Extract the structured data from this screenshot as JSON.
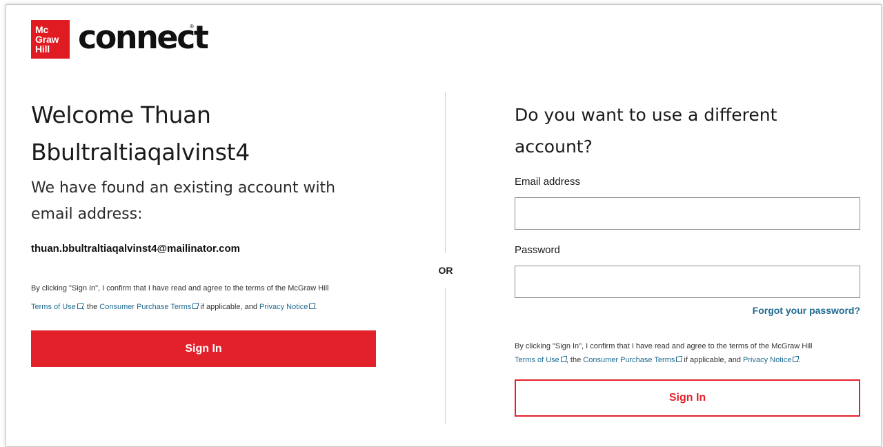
{
  "logo": {
    "line1": "Mc",
    "line2": "Graw",
    "line3": "Hill",
    "brand": "connect",
    "reg": "®"
  },
  "left": {
    "welcome_line1": "Welcome Thuan",
    "welcome_line2": "Bbultraltiaqalvinst4",
    "found_text": "We have found an existing account with email address:",
    "email": "thuan.bbultraltiaqalvinst4@mailinator.com",
    "terms_intro": "By clicking \"Sign In\", I confirm that I have read and agree to the terms of the McGraw Hill",
    "terms_of_use": "Terms of Use",
    "terms_sep1": ", the",
    "consumer_terms": "Consumer Purchase Terms",
    "terms_sep2": "if applicable, and",
    "privacy": "Privacy Notice",
    "terms_end": ".",
    "sign_in": "Sign In"
  },
  "divider": {
    "or": "OR"
  },
  "right": {
    "title": "Do you want to use a different account?",
    "email_label": "Email address",
    "password_label": "Password",
    "forgot": "Forgot your password?",
    "terms_intro": "By clicking \"Sign In\", I confirm that I have read and agree to the terms of the McGraw Hill",
    "terms_of_use": "Terms of Use",
    "terms_sep1": ", the",
    "consumer_terms": "Consumer Purchase Terms",
    "terms_sep2": "if applicable, and",
    "privacy": "Privacy Notice",
    "terms_end": ".",
    "sign_in": "Sign In"
  },
  "colors": {
    "brand_red": "#e3212b",
    "link_blue": "#1f6b92"
  }
}
